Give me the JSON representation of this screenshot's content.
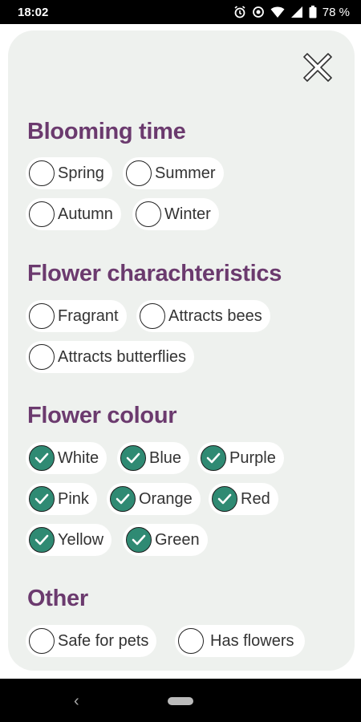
{
  "status": {
    "time": "18:02",
    "battery": "78 %"
  },
  "sections": {
    "blooming": {
      "title": "Blooming time",
      "options": [
        "Spring",
        "Summer",
        "Autumn",
        "Winter"
      ]
    },
    "characteristics": {
      "title": "Flower charachteristics",
      "options": [
        "Fragrant",
        "Attracts bees",
        "Attracts butterflies"
      ]
    },
    "colour": {
      "title": "Flower colour",
      "options": [
        "White",
        "Blue",
        "Purple",
        "Pink",
        "Orange",
        "Red",
        "Yellow",
        "Green"
      ]
    },
    "other": {
      "title": "Other",
      "options": [
        "Safe for pets",
        "Has flowers"
      ]
    }
  },
  "colors": {
    "accent": "#2f8a73",
    "heading": "#6b3a6e",
    "card": "#eef1ee"
  },
  "icons": {
    "close": "close-icon",
    "checked": "check-icon"
  }
}
